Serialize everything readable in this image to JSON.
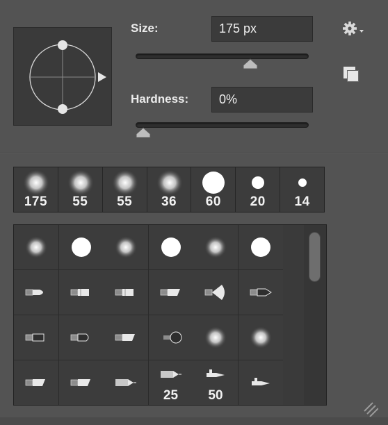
{
  "size": {
    "label": "Size:",
    "value": "175 px",
    "slider_fraction": 0.68
  },
  "hardness": {
    "label": "Hardness:",
    "value": "0%",
    "slider_fraction": 0.0
  },
  "icons": {
    "settings": "gear-icon",
    "new_preset": "new-preset-icon",
    "resize": "resize-grip-icon"
  },
  "recent_brushes": [
    {
      "label": "175",
      "kind": "soft"
    },
    {
      "label": "55",
      "kind": "soft"
    },
    {
      "label": "55",
      "kind": "soft"
    },
    {
      "label": "36",
      "kind": "soft"
    },
    {
      "label": "60",
      "kind": "hard"
    },
    {
      "label": "20",
      "kind": "hard"
    },
    {
      "label": "14",
      "kind": "hard"
    }
  ],
  "preset_brushes": [
    [
      {
        "kind": "soft",
        "label": ""
      },
      {
        "kind": "hard",
        "label": ""
      },
      {
        "kind": "soft",
        "label": ""
      },
      {
        "kind": "hard",
        "label": ""
      },
      {
        "kind": "soft",
        "label": ""
      },
      {
        "kind": "hard",
        "label": ""
      }
    ],
    [
      {
        "kind": "round-tip",
        "label": ""
      },
      {
        "kind": "flat-tip",
        "label": ""
      },
      {
        "kind": "flat-tip",
        "label": ""
      },
      {
        "kind": "angle-tip",
        "label": ""
      },
      {
        "kind": "fan-tip",
        "label": ""
      },
      {
        "kind": "point-tip",
        "label": ""
      }
    ],
    [
      {
        "kind": "blunt-tip",
        "label": ""
      },
      {
        "kind": "round-blunt",
        "label": ""
      },
      {
        "kind": "angle-tip",
        "label": ""
      },
      {
        "kind": "stipple",
        "label": ""
      },
      {
        "kind": "soft",
        "label": ""
      },
      {
        "kind": "soft",
        "label": ""
      }
    ],
    [
      {
        "kind": "angle-tip",
        "label": ""
      },
      {
        "kind": "angle-tip",
        "label": ""
      },
      {
        "kind": "pencil",
        "label": ""
      },
      {
        "kind": "pencil",
        "label": "25"
      },
      {
        "kind": "airbrush",
        "label": "50"
      },
      {
        "kind": "airbrush",
        "label": ""
      }
    ]
  ]
}
